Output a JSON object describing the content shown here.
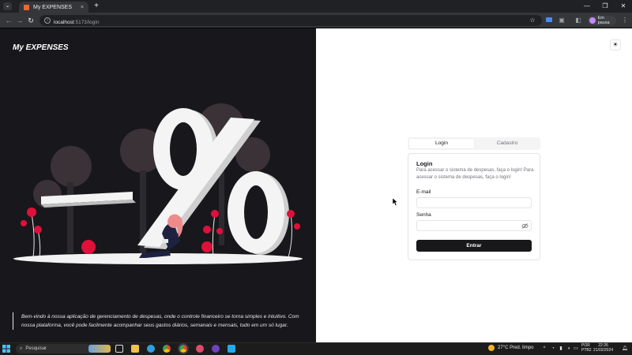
{
  "browser": {
    "tab_title": "My EXPENSES",
    "tab_close": "×",
    "tablist_icon": "⌄",
    "new_tab": "+",
    "window_controls": [
      "—",
      "❐",
      "✕"
    ],
    "url_host": "localhost",
    "url_path": ":5173/login",
    "profile_label": "Em pausa",
    "menu_icon": "⋮"
  },
  "left_panel": {
    "brand": "My EXPENSES",
    "description": "Bem-vindo à nossa aplicação de gerenciamento de despesas, onde o controle financeiro se torna simples e intuitivo. Com nossa plataforma, você pode facilmente acompanhar seus gastos diários, semanais e mensais, tudo em um só lugar."
  },
  "auth": {
    "tabs": [
      "Login",
      "Cadastro"
    ],
    "active_tab": "Login",
    "card_title": "Login",
    "card_description": "Para acessar o sistema de despesas, faça o login! Para acessar o sistema de despesas, faça o login!",
    "email_label": "E-mail",
    "email_value": "",
    "password_label": "Senha",
    "password_value": "",
    "submit_label": "Entrar"
  },
  "taskbar": {
    "search_placeholder": "Pesquisar",
    "weather": "27°C  Pred. limpo",
    "language_line1": "POR",
    "language_line2": "PTB2",
    "time": "22:26",
    "date": "21/02/2024"
  },
  "colors": {
    "accent_dark": "#18181b",
    "left_bg": "#18171c",
    "flower_red": "#e0103a",
    "person_hair": "#f08a8a"
  },
  "icons": {
    "theme_toggle": "sun-icon",
    "password_visibility": "eye-off-icon"
  }
}
